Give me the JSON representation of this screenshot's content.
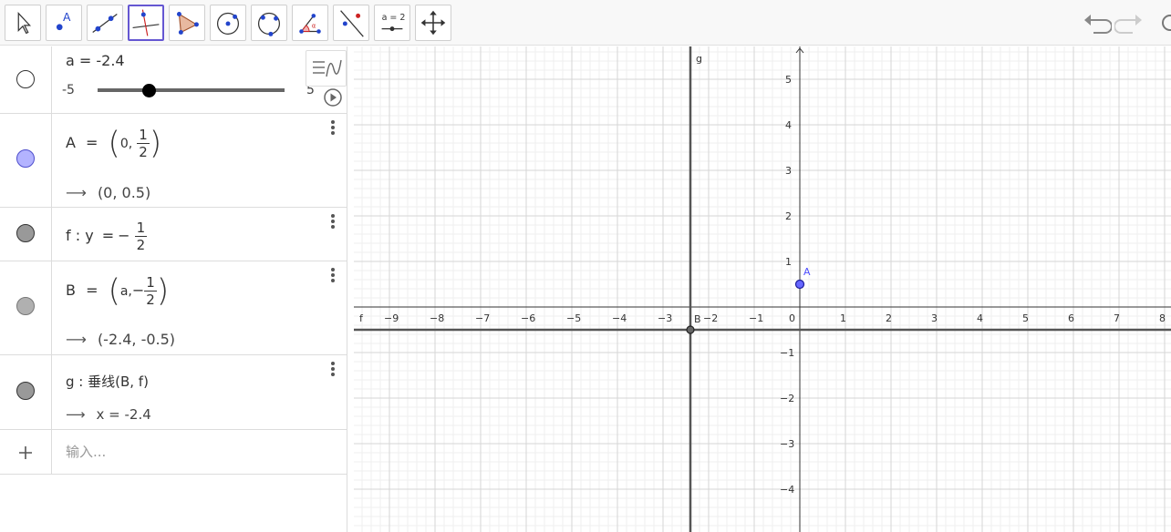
{
  "toolbar": {
    "tools": [
      {
        "name": "move-tool",
        "active": false
      },
      {
        "name": "point-tool",
        "active": false,
        "label": "A"
      },
      {
        "name": "line-tool",
        "active": false
      },
      {
        "name": "perpendicular-line-tool",
        "active": true
      },
      {
        "name": "polygon-tool",
        "active": false
      },
      {
        "name": "circle-center-point-tool",
        "active": false
      },
      {
        "name": "circle-three-points-tool",
        "active": false
      },
      {
        "name": "angle-tool",
        "active": false
      },
      {
        "name": "reflect-tool",
        "active": false
      },
      {
        "name": "slider-tool",
        "active": false,
        "label": "a = 2"
      },
      {
        "name": "move-graphics-view-tool",
        "active": false
      }
    ]
  },
  "algebra": {
    "slider": {
      "name_text": "a = -2.4",
      "min": "-5",
      "max": "5",
      "value": -2.4
    },
    "A": {
      "lhs": "A",
      "num": "1",
      "den": "2",
      "x": "0,",
      "output": "(0, 0.5)"
    },
    "f": {
      "lhs": "f : y",
      "neg": "−",
      "num": "1",
      "den": "2"
    },
    "B": {
      "lhs": "B",
      "a": "a,",
      "neg": "−",
      "num": "1",
      "den": "2",
      "output": "(-2.4, -0.5)"
    },
    "g": {
      "def": "g : 垂线(B, f)",
      "output": "x = -2.4"
    },
    "input": {
      "placeholder": "输入..."
    }
  },
  "graphics": {
    "x_ticks": [
      "-9",
      "-8",
      "-7",
      "-6",
      "-5",
      "-4",
      "-3",
      "-2",
      "-1",
      "0",
      "1",
      "2",
      "3",
      "4",
      "5",
      "6",
      "7",
      "8"
    ],
    "y_ticks": [
      "5",
      "4",
      "3",
      "2",
      "1",
      "-1",
      "-2",
      "-3",
      "-4"
    ],
    "labels": {
      "f": "f",
      "g": "g",
      "A": "A",
      "B": "B"
    },
    "colors": {
      "point_A": "#6666ff",
      "axis": "#333333",
      "grid_major": "#d6d6d6",
      "grid_minor": "#efefef"
    }
  }
}
